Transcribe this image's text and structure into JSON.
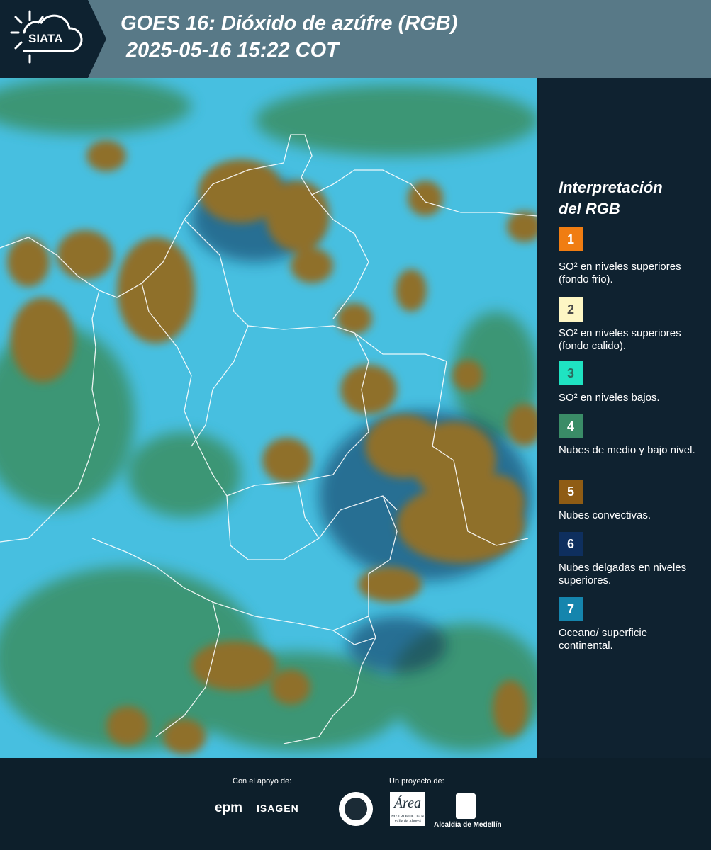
{
  "header": {
    "logo_text": "SIATA",
    "title_line1": "GOES 16: Dióxido de azúfre (RGB)",
    "title_line2": " 2025-05-16 15:22 COT"
  },
  "legend": {
    "title_line1": "Interpretación",
    "title_line2": "del RGB",
    "items": [
      {
        "number": "1",
        "color": "#f07d12",
        "text": "SO² en niveles superiores (fondo frio)."
      },
      {
        "number": "2",
        "color": "#fdf6c4",
        "text": "SO² en niveles superiores (fondo calido)."
      },
      {
        "number": "3",
        "color": "#1fe3c2",
        "text": "SO² en niveles bajos."
      },
      {
        "number": "4",
        "color": "#3a8c67",
        "text": "Nubes de medio y bajo nivel."
      },
      {
        "number": "5",
        "color": "#8f5c14",
        "text": "Nubes convectivas."
      },
      {
        "number": "6",
        "color": "#0e2f5e",
        "text": "Nubes delgadas en niveles superiores."
      },
      {
        "number": "7",
        "color": "#1585ad",
        "text": "Oceano/ superficie continental."
      }
    ]
  },
  "footer": {
    "support_label": "Con el apoyo de:",
    "project_label": "Un proyecto de:",
    "epm": "epm",
    "isagen": "ISAGEN",
    "area": "Área",
    "area_sub": "METROPOLITANA Valle de Aburrá",
    "alcaldia": "Alcaldía de Medellín"
  },
  "map": {
    "colors": {
      "surface": "#47bfe0",
      "low_cloud": "#3a8f63",
      "convective": "#8f6f2b",
      "thin_high": "#0f2f55",
      "borders": "#ffffff"
    }
  }
}
